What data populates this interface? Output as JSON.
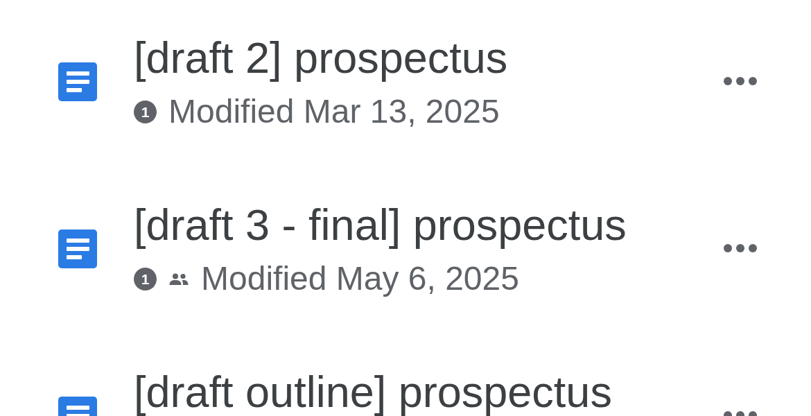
{
  "files": [
    {
      "title": "[draft 2] prospectus",
      "badge": "1",
      "shared": false,
      "modified": "Modified Mar 13, 2025"
    },
    {
      "title": "[draft 3 - final] prospectus",
      "badge": "1",
      "shared": true,
      "modified": "Modified May 6, 2025"
    },
    {
      "title": "[draft outline] prospectus"
    }
  ]
}
